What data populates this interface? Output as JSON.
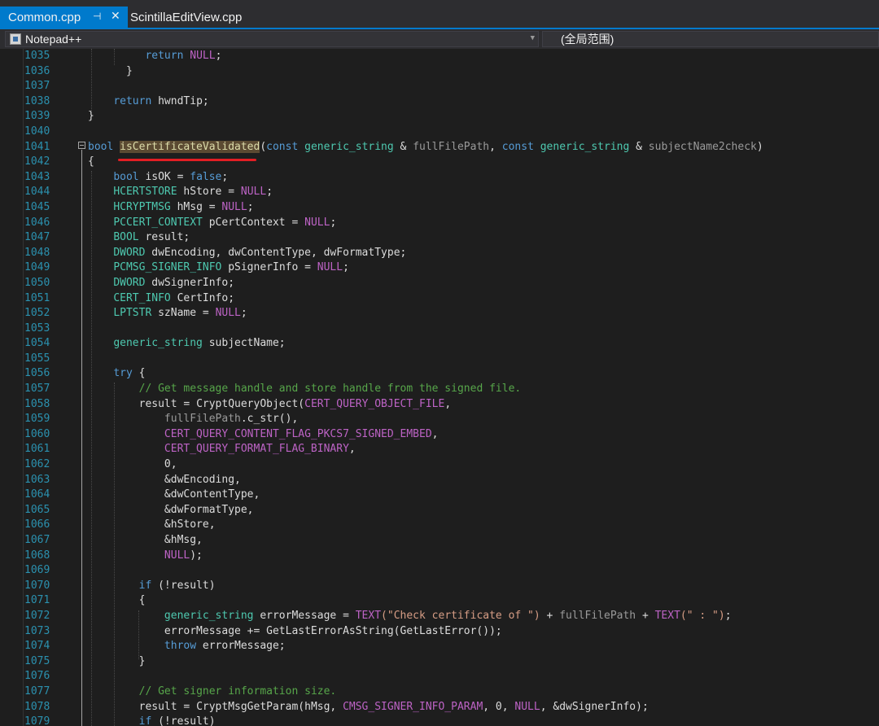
{
  "tabs": [
    {
      "label": "Common.cpp",
      "active": true,
      "pin_icon": "pin-icon",
      "close_icon": "close-icon"
    },
    {
      "label": "ScintillaEditView.cpp",
      "active": false
    }
  ],
  "nav": {
    "project": "Notepad++",
    "scope": "(全局范围)"
  },
  "colors": {
    "accent": "#007acc",
    "keyword": "#569cd6",
    "type": "#4ec9b0",
    "macro": "#bd63c5",
    "comment": "#57a64a",
    "string": "#d69d85",
    "line_number": "#2b91af",
    "highlight_underline": "#e31e24"
  },
  "line_numbers": [
    "1035",
    "1036",
    "1037",
    "1038",
    "1039",
    "1040",
    "1041",
    "1042",
    "1043",
    "1044",
    "1045",
    "1046",
    "1047",
    "1048",
    "1049",
    "1050",
    "1051",
    "1052",
    "1053",
    "1054",
    "1055",
    "1056",
    "1057",
    "1058",
    "1059",
    "1060",
    "1061",
    "1062",
    "1063",
    "1064",
    "1065",
    "1066",
    "1067",
    "1068",
    "1069",
    "1070",
    "1071",
    "1072",
    "1073",
    "1074",
    "1075",
    "1076",
    "1077",
    "1078",
    "1079"
  ],
  "code": {
    "l1035": {
      "kw": "return",
      "mac": "NULL",
      "tail": ";"
    },
    "l1036": {
      "text": "}"
    },
    "l1038": {
      "kw": "return",
      "tail": " hwndTip;"
    },
    "l1039": {
      "text": "}"
    },
    "l1041": {
      "kw_bool": "bool",
      "fn": "isCertificateValidated",
      "open": "(",
      "kw_const1": "const",
      "ty1": "generic_string",
      "amp1": " & ",
      "pm1": "fullFilePath",
      "comma": ", ",
      "kw_const2": "const",
      "ty2": "generic_string",
      "amp2": " & ",
      "pm2": "subjectName2check",
      "close": ")"
    },
    "l1042": {
      "text": "{"
    },
    "l1043": {
      "kw": "bool",
      "mid": " isOK = ",
      "kw2": "false",
      "tail": ";"
    },
    "l1044": {
      "ty": "HCERTSTORE",
      "mid": " hStore = ",
      "mac": "NULL",
      "tail": ";"
    },
    "l1045": {
      "ty": "HCRYPTMSG",
      "mid": " hMsg = ",
      "mac": "NULL",
      "tail": ";"
    },
    "l1046": {
      "ty": "PCCERT_CONTEXT",
      "mid": " pCertContext = ",
      "mac": "NULL",
      "tail": ";"
    },
    "l1047": {
      "ty": "BOOL",
      "tail": " result;"
    },
    "l1048": {
      "ty": "DWORD",
      "tail": " dwEncoding, dwContentType, dwFormatType;"
    },
    "l1049": {
      "ty": "PCMSG_SIGNER_INFO",
      "mid": " pSignerInfo = ",
      "mac": "NULL",
      "tail": ";"
    },
    "l1050": {
      "ty": "DWORD",
      "tail": " dwSignerInfo;"
    },
    "l1051": {
      "ty": "CERT_INFO",
      "tail": " CertInfo;"
    },
    "l1052": {
      "ty": "LPTSTR",
      "mid": " szName = ",
      "mac": "NULL",
      "tail": ";"
    },
    "l1054": {
      "ty": "generic_string",
      "tail": " subjectName;"
    },
    "l1056": {
      "kw": "try",
      "tail": " {"
    },
    "l1057": {
      "cm": "// Get message handle and store handle from the signed file."
    },
    "l1058": {
      "pre": "result = CryptQueryObject(",
      "mac": "CERT_QUERY_OBJECT_FILE",
      "tail": ","
    },
    "l1059": {
      "pm": "fullFilePath",
      "tail": ".c_str(),"
    },
    "l1060": {
      "mac": "CERT_QUERY_CONTENT_FLAG_PKCS7_SIGNED_EMBED",
      "tail": ","
    },
    "l1061": {
      "mac": "CERT_QUERY_FORMAT_FLAG_BINARY",
      "tail": ","
    },
    "l1062": {
      "text": "0,"
    },
    "l1063": {
      "text": "&dwEncoding,"
    },
    "l1064": {
      "text": "&dwContentType,"
    },
    "l1065": {
      "text": "&dwFormatType,"
    },
    "l1066": {
      "text": "&hStore,"
    },
    "l1067": {
      "text": "&hMsg,"
    },
    "l1068": {
      "mac": "NULL",
      "tail": ");"
    },
    "l1070": {
      "kw": "if",
      "tail": " (!result)"
    },
    "l1071": {
      "text": "{"
    },
    "l1072": {
      "ty": "generic_string",
      "mid": " errorMessage = ",
      "mac1": "TEXT",
      "st1": "(\"Check certificate of \")",
      "plus1": " + ",
      "pm": "fullFilePath",
      "plus2": " + ",
      "mac2": "TEXT",
      "st2": "(\" : \")",
      "tail": ";"
    },
    "l1073": {
      "text": "errorMessage += GetLastErrorAsString(GetLastError());"
    },
    "l1074": {
      "kw": "throw",
      "tail": " errorMessage;"
    },
    "l1075": {
      "text": "}"
    },
    "l1077": {
      "cm": "// Get signer information size."
    },
    "l1078": {
      "pre": "result = CryptMsgGetParam(hMsg, ",
      "mac1": "CMSG_SIGNER_INFO_PARAM",
      "mid": ", 0, ",
      "mac2": "NULL",
      "tail": ", &dwSignerInfo);"
    },
    "l1079": {
      "kw": "if",
      "tail": " (!result)"
    }
  }
}
